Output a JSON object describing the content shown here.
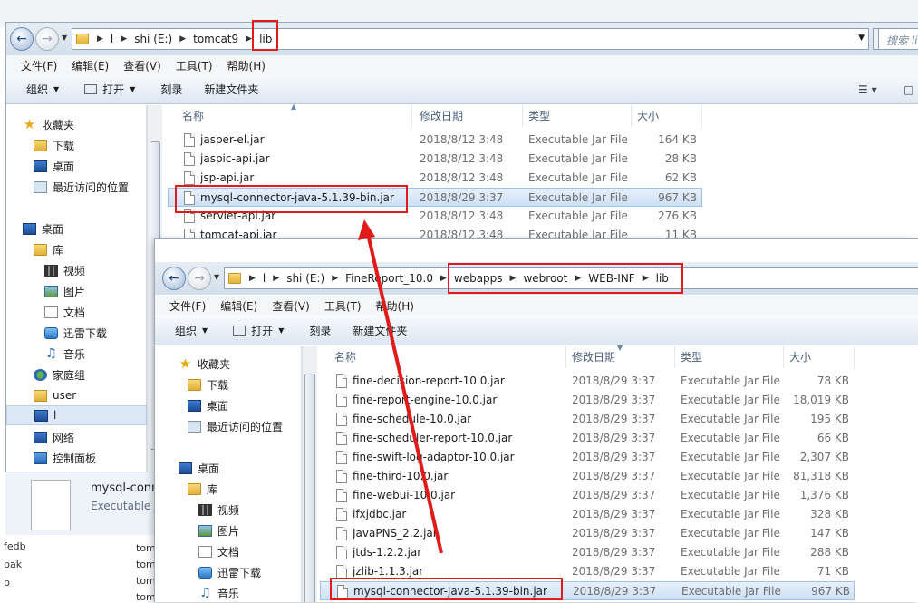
{
  "bg": {
    "left_rows": [
      "fedb",
      "bak",
      "b"
    ],
    "tomcat_rows": [
      "tomc",
      "tomc",
      "tomc",
      "tomc"
    ]
  },
  "window1": {
    "breadcrumb": [
      "l",
      "shi (E:)",
      "tomcat9",
      "lib"
    ],
    "search_placeholder": "搜索 lib",
    "menu": [
      "文件(F)",
      "编辑(E)",
      "查看(V)",
      "工具(T)",
      "帮助(H)"
    ],
    "toolbar": {
      "organize": "组织",
      "open": "打开",
      "burn": "刻录",
      "new_folder": "新建文件夹"
    },
    "nav": [
      {
        "label": "收藏夹",
        "icon": "star"
      },
      {
        "label": "下载",
        "icon": "dl"
      },
      {
        "label": "桌面",
        "icon": "screen"
      },
      {
        "label": "最近访问的位置",
        "icon": "recent"
      },
      {
        "label": "桌面",
        "icon": "screen"
      },
      {
        "label": "库",
        "icon": "folder"
      },
      {
        "label": "视频",
        "icon": "film"
      },
      {
        "label": "图片",
        "icon": "pic"
      },
      {
        "label": "文档",
        "icon": "doc"
      },
      {
        "label": "迅雷下载",
        "icon": "dl"
      },
      {
        "label": "音乐",
        "icon": "music"
      },
      {
        "label": "家庭组",
        "icon": "group"
      },
      {
        "label": "user",
        "icon": "user"
      },
      {
        "label": "l",
        "icon": "screen"
      },
      {
        "label": "网络",
        "icon": "net"
      },
      {
        "label": "控制面板",
        "icon": "cpanel"
      }
    ],
    "columns": {
      "name": "名称",
      "date": "修改日期",
      "type": "类型",
      "size": "大小"
    },
    "files": [
      {
        "name": "jasper-el.jar",
        "date": "2018/8/12 3:48",
        "type": "Executable Jar File",
        "size": "164 KB"
      },
      {
        "name": "jaspic-api.jar",
        "date": "2018/8/12 3:48",
        "type": "Executable Jar File",
        "size": "28 KB"
      },
      {
        "name": "jsp-api.jar",
        "date": "2018/8/12 3:48",
        "type": "Executable Jar File",
        "size": "62 KB"
      },
      {
        "name": "mysql-connector-java-5.1.39-bin.jar",
        "date": "2018/8/29 3:37",
        "type": "Executable Jar File",
        "size": "967 KB"
      },
      {
        "name": "servlet-api.jar",
        "date": "2018/8/12 3:48",
        "type": "Executable Jar File",
        "size": "276 KB"
      },
      {
        "name": "tomcat-api.jar",
        "date": "2018/8/12 3:48",
        "type": "Executable Jar File",
        "size": "11 KB"
      }
    ],
    "details": {
      "name": "mysql-connec",
      "type": "Executable Ja"
    }
  },
  "window2": {
    "breadcrumb": [
      "l",
      "shi (E:)",
      "FineReport_10.0",
      "webapps",
      "webroot",
      "WEB-INF",
      "lib"
    ],
    "menu": [
      "文件(F)",
      "编辑(E)",
      "查看(V)",
      "工具(T)",
      "帮助(H)"
    ],
    "toolbar": {
      "organize": "组织",
      "open": "打开",
      "burn": "刻录",
      "new_folder": "新建文件夹"
    },
    "nav": [
      {
        "label": "收藏夹",
        "icon": "star"
      },
      {
        "label": "下载",
        "icon": "dl"
      },
      {
        "label": "桌面",
        "icon": "screen"
      },
      {
        "label": "最近访问的位置",
        "icon": "recent"
      },
      {
        "label": "桌面",
        "icon": "screen"
      },
      {
        "label": "库",
        "icon": "folder"
      },
      {
        "label": "视频",
        "icon": "film"
      },
      {
        "label": "图片",
        "icon": "pic"
      },
      {
        "label": "文档",
        "icon": "doc"
      },
      {
        "label": "迅雷下载",
        "icon": "dl"
      },
      {
        "label": "音乐",
        "icon": "music"
      }
    ],
    "columns": {
      "name": "名称",
      "date": "修改日期",
      "type": "类型",
      "size": "大小"
    },
    "files": [
      {
        "name": "fine-decision-report-10.0.jar",
        "date": "2018/8/29 3:37",
        "type": "Executable Jar File",
        "size": "78 KB"
      },
      {
        "name": "fine-report-engine-10.0.jar",
        "date": "2018/8/29 3:37",
        "type": "Executable Jar File",
        "size": "18,019 KB"
      },
      {
        "name": "fine-schedule-10.0.jar",
        "date": "2018/8/29 3:37",
        "type": "Executable Jar File",
        "size": "195 KB"
      },
      {
        "name": "fine-scheduler-report-10.0.jar",
        "date": "2018/8/29 3:37",
        "type": "Executable Jar File",
        "size": "66 KB"
      },
      {
        "name": "fine-swift-log-adaptor-10.0.jar",
        "date": "2018/8/29 3:37",
        "type": "Executable Jar File",
        "size": "2,307 KB"
      },
      {
        "name": "fine-third-10.0.jar",
        "date": "2018/8/29 3:37",
        "type": "Executable Jar File",
        "size": "81,318 KB"
      },
      {
        "name": "fine-webui-10.0.jar",
        "date": "2018/8/29 3:37",
        "type": "Executable Jar File",
        "size": "1,376 KB"
      },
      {
        "name": "ifxjdbc.jar",
        "date": "2018/8/29 3:37",
        "type": "Executable Jar File",
        "size": "328 KB"
      },
      {
        "name": "JavaPNS_2.2.jar",
        "date": "2018/8/29 3:37",
        "type": "Executable Jar File",
        "size": "147 KB"
      },
      {
        "name": "jtds-1.2.2.jar",
        "date": "2018/8/29 3:37",
        "type": "Executable Jar File",
        "size": "288 KB"
      },
      {
        "name": "jzlib-1.1.3.jar",
        "date": "2018/8/29 3:37",
        "type": "Executable Jar File",
        "size": "71 KB"
      },
      {
        "name": "mysql-connector-java-5.1.39-bin.jar",
        "date": "2018/8/29 3:37",
        "type": "Executable Jar File",
        "size": "967 KB"
      }
    ]
  },
  "colors": {
    "highlight": "#e11a1a",
    "selection": "#cfe0f6"
  }
}
